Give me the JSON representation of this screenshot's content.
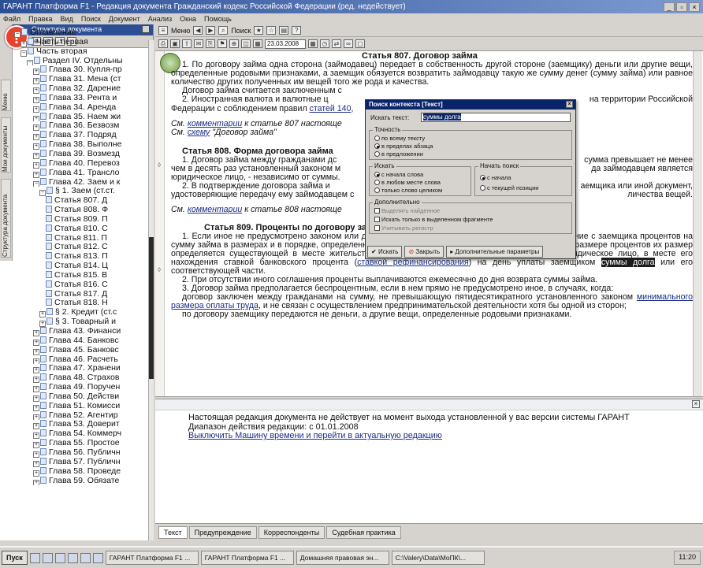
{
  "window": {
    "title": "ГАРАНТ Платформа F1 - Редакция документа Гражданский кодекс Российской Федерации (ред. недействует)",
    "btn_min": "_",
    "btn_max": "▫",
    "btn_close": "×"
  },
  "menu": [
    "Файл",
    "Правка",
    "Вид",
    "Поиск",
    "Документ",
    "Анализ",
    "Окна",
    "Помощь"
  ],
  "left_panel": {
    "header": "Структура документа",
    "alert_mark": "!",
    "vertical_tabs": [
      "Меню",
      "Мои документы",
      "Структура документа"
    ],
    "tree": [
      {
        "indent": 0,
        "exp": "−",
        "label": "Оглавление"
      },
      {
        "indent": 1,
        "exp": "+",
        "label": "Часть первая"
      },
      {
        "indent": 1,
        "exp": "−",
        "label": "Часть вторая"
      },
      {
        "indent": 2,
        "exp": "−",
        "label": "Раздел IV. Отдельны"
      },
      {
        "indent": 3,
        "exp": "+",
        "label": "Глава 30. Купля-пр"
      },
      {
        "indent": 3,
        "exp": "+",
        "label": "Глава 31. Мена (ст"
      },
      {
        "indent": 3,
        "exp": "+",
        "label": "Глава 32. Дарение"
      },
      {
        "indent": 3,
        "exp": "+",
        "label": "Глава 33. Рента и"
      },
      {
        "indent": 3,
        "exp": "+",
        "label": "Глава 34. Аренда"
      },
      {
        "indent": 3,
        "exp": "+",
        "label": "Глава 35. Наем жи"
      },
      {
        "indent": 3,
        "exp": "+",
        "label": "Глава 36. Безвозм"
      },
      {
        "indent": 3,
        "exp": "+",
        "label": "Глава 37. Подряд"
      },
      {
        "indent": 3,
        "exp": "+",
        "label": "Глава 38. Выполне"
      },
      {
        "indent": 3,
        "exp": "+",
        "label": "Глава 39. Возмезд"
      },
      {
        "indent": 3,
        "exp": "+",
        "label": "Глава 40. Перевоз"
      },
      {
        "indent": 3,
        "exp": "+",
        "label": "Глава 41. Трансло"
      },
      {
        "indent": 3,
        "exp": "−",
        "label": "Глава 42. Заем и к"
      },
      {
        "indent": 4,
        "exp": "−",
        "label": "§ 1. Заем (ст.ст."
      },
      {
        "indent": 5,
        "exp": "",
        "label": "Статья 807. Д"
      },
      {
        "indent": 5,
        "exp": "",
        "label": "Статья 808. Ф"
      },
      {
        "indent": 5,
        "exp": "",
        "label": "Статья 809. П"
      },
      {
        "indent": 5,
        "exp": "",
        "label": "Статья 810. С"
      },
      {
        "indent": 5,
        "exp": "",
        "label": "Статья 811. П"
      },
      {
        "indent": 5,
        "exp": "",
        "label": "Статья 812. С"
      },
      {
        "indent": 5,
        "exp": "",
        "label": "Статья 813. П"
      },
      {
        "indent": 5,
        "exp": "",
        "label": "Статья 814. Ц"
      },
      {
        "indent": 5,
        "exp": "",
        "label": "Статья 815. В"
      },
      {
        "indent": 5,
        "exp": "",
        "label": "Статья 816. С"
      },
      {
        "indent": 5,
        "exp": "",
        "label": "Статья 817. Д"
      },
      {
        "indent": 5,
        "exp": "",
        "label": "Статья 818. Н"
      },
      {
        "indent": 4,
        "exp": "+",
        "label": "§ 2. Кредит (ст.с"
      },
      {
        "indent": 4,
        "exp": "+",
        "label": "§ 3. Товарный и"
      },
      {
        "indent": 3,
        "exp": "+",
        "label": "Глава 43. Финанси"
      },
      {
        "indent": 3,
        "exp": "+",
        "label": "Глава 44. Банковс"
      },
      {
        "indent": 3,
        "exp": "+",
        "label": "Глава 45. Банковс"
      },
      {
        "indent": 3,
        "exp": "+",
        "label": "Глава 46. Расчеть"
      },
      {
        "indent": 3,
        "exp": "+",
        "label": "Глава 47. Хранени"
      },
      {
        "indent": 3,
        "exp": "+",
        "label": "Глава 48. Страхов"
      },
      {
        "indent": 3,
        "exp": "+",
        "label": "Глава 49. Поручен"
      },
      {
        "indent": 3,
        "exp": "+",
        "label": "Глава 50. Действи"
      },
      {
        "indent": 3,
        "exp": "+",
        "label": "Глава 51. Комисси"
      },
      {
        "indent": 3,
        "exp": "+",
        "label": "Глава 52. Агентир"
      },
      {
        "indent": 3,
        "exp": "+",
        "label": "Глава 53. Доверит"
      },
      {
        "indent": 3,
        "exp": "+",
        "label": "Глава 54. Коммерч"
      },
      {
        "indent": 3,
        "exp": "+",
        "label": "Глава 55. Простое"
      },
      {
        "indent": 3,
        "exp": "+",
        "label": "Глава 56. Публичн"
      },
      {
        "indent": 3,
        "exp": "+",
        "label": "Глава 57. Публичн"
      },
      {
        "indent": 3,
        "exp": "+",
        "label": "Глава 58. Проведе"
      },
      {
        "indent": 3,
        "exp": "+",
        "label": "Глава 59. Обязате"
      }
    ]
  },
  "toolbar1": {
    "menu_label": "Меню",
    "search_label": "Поиск"
  },
  "toolbar2": {
    "date": "23.03.2008"
  },
  "document": {
    "a807_title": "Статья 807. Договор займа",
    "a807_p1": "1. По договору займа одна сторона (займодавец) передает в собственность другой стороне (заемщику) деньги или другие вещи, определенные родовыми признаками, а заемщик обязуется возвратить займодавцу такую же сумму денег (сумму займа) или равное количество других полученных им вещей того же рода и качества.",
    "a807_p2": "Договор займа считается заключенным с",
    "a807_p3a": "2. Иностранная валюта и валютные ц",
    "a807_p3b": "на территории Российской",
    "a807_p3c": "Федерации с соблюдением правил",
    "a807_p3link": "статей 140,",
    "see1_pre": "См.",
    "see1_link": "комментарии",
    "see1_post": "к статье 807 настояще",
    "see2_pre": "См.",
    "see2_link": "схему",
    "see2_post": "\"Договор займа\"",
    "a808_title": "Статья 808. Форма договора займа",
    "a808_p1a": "1. Договор займа между гражданами дс",
    "a808_p1b": "сумма превышает не менее",
    "a808_p1c": "чем в десять раз установленный законом м",
    "a808_p1d": "да займодавцем является",
    "a808_p1e": "юридическое лицо, - независимо от суммы.",
    "a808_p2a": "2. В подтверждение договора займа и",
    "a808_p2b": "аемщика или иной документ,",
    "a808_p2c": "удостоверяющие передачу ему займодавцем с",
    "a808_p2d": "личества вещей.",
    "see3_pre": "См.",
    "see3_link": "комментарии",
    "see3_post": "к статье 808 настояще",
    "a809_title": "Статья 809. Проценты по договору займа",
    "a809_p1_a": "1. Если иное не предусмотрено законом или договором займа, займодавец имеет право на получение с заемщика процентов на сумму займа в размерах и в порядке, определенных договором. При отсутствии в договоре условия о размере процентов их размер определяется существующей в месте жительства займодавца, а если займодавцем является юридическое лицо, в месте его нахождения ставкой банковского процента (",
    "a809_p1_link": "ставкой рефинансирования",
    "a809_p1_b": ") на день уплаты заемщиком",
    "a809_p1_hl": "суммы долга",
    "a809_p1_c": "или его соответствующей части.",
    "a809_p2": "2. При отсутствии иного соглашения проценты выплачиваются ежемесячно до дня возврата суммы займа.",
    "a809_p3": "3. Договор займа предполагается беспроцентным, если в нем прямо не предусмотрено иное, в случаях, когда:",
    "a809_p3_1a": "договор заключен между гражданами на сумму, не превышающую пятидесятикратного установленного законом",
    "a809_p3_1link": "минимального размера оплаты труда",
    "a809_p3_1b": ", и не связан с осуществлением предпринимательской деятельности хотя бы одной из сторон;",
    "a809_p3_2": "по договору заемщику передаются не деньги, а другие вещи, определенные родовыми признаками."
  },
  "notice": {
    "line1": "Настоящая редакция документа не действует на момент выхода установленной у вас версии системы ГАРАНТ",
    "line2": "Диапазон действия редакции: с 01.01.2008",
    "line3": "Выключить Машину времени и перейти в актуальную редакцию"
  },
  "bottom_tabs": [
    "Текст",
    "Предупреждение",
    "Корреспонденты",
    "Судебная практика"
  ],
  "dialog": {
    "title": "Поиск контекста [Текст]",
    "search_label": "Искать текст:",
    "search_value": "суммы долга",
    "group_accuracy": "Точность",
    "acc_opts": [
      "по всему тексту",
      "в пределах абзаца",
      "в предложении"
    ],
    "group_find": "Искать",
    "find_opts": [
      "с начала слова",
      "в любом месте слова",
      "только слово целиком"
    ],
    "group_start": "Начать поиск",
    "start_opts": [
      "с начала",
      "с текущей позиции"
    ],
    "group_extra": "Дополнительно",
    "extra_opts": [
      "Выделять найденное",
      "Искать только в выделенном фрагменте",
      "Учитывать регистр"
    ],
    "btn_find": "Искать",
    "btn_close": "Закрыть",
    "btn_more": "Дополнительные параметры"
  },
  "taskbar": {
    "start": "Пуск",
    "items": [
      "ГАРАНТ Платформа F1 ...",
      "ГАРАНТ Платформа F1 ...",
      "Домашняя правовая эн...",
      "C:\\Valery\\Data\\MоПК\\..."
    ],
    "clock": "11:20"
  }
}
